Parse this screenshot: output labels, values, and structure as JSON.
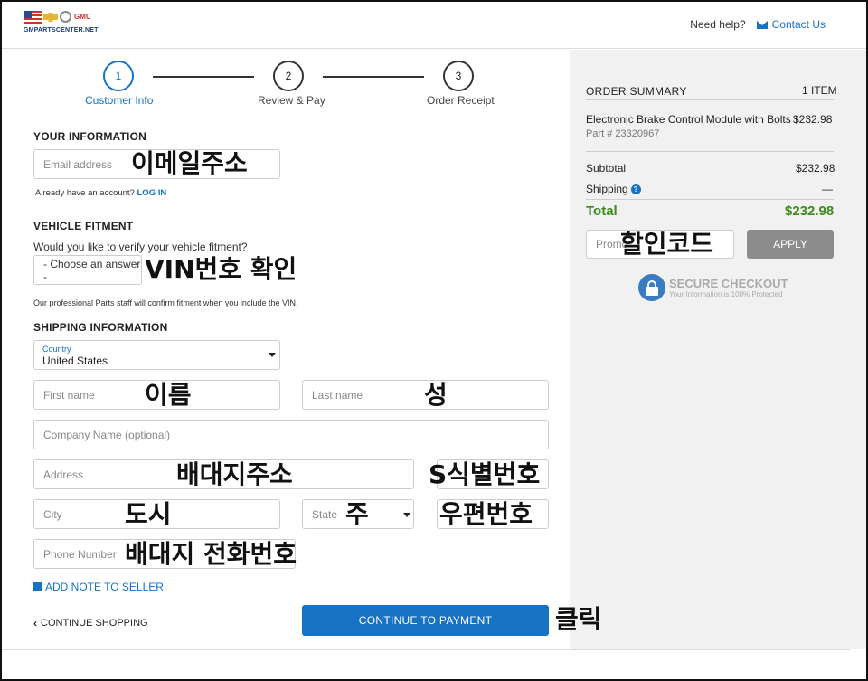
{
  "header": {
    "logo_text": "GMPARTSCENTER.NET",
    "logo_gmc": "GMC",
    "help_text": "Need help?",
    "contact_label": "Contact Us"
  },
  "steps": [
    {
      "num": "1",
      "label": "Customer Info"
    },
    {
      "num": "2",
      "label": "Review & Pay"
    },
    {
      "num": "3",
      "label": "Order Receipt"
    }
  ],
  "your_info": {
    "title": "YOUR INFORMATION",
    "email_placeholder": "Email address",
    "email_annotation": "이메일주소",
    "account_prompt": "Already have an account?",
    "login_link": "LOG IN"
  },
  "vehicle": {
    "title": "VEHICLE FITMENT",
    "question": "Would you like to verify your vehicle fitment?",
    "select_value": "- Choose an answer -",
    "select_annotation": "VIN번호 확인",
    "note": "Our professional Parts staff will confirm fitment when you include the VIN."
  },
  "shipping": {
    "title": "SHIPPING INFORMATION",
    "country_label": "Country",
    "country_value": "United States",
    "first_name_placeholder": "First name",
    "first_name_annotation": "이름",
    "last_name_placeholder": "Last name",
    "last_name_annotation": "성",
    "company_placeholder": "Company Name (optional)",
    "address_placeholder": "Address",
    "address_annotation": "배대지주소",
    "address2_annotation": "S식별번호",
    "city_placeholder": "City",
    "city_annotation": "도시",
    "state_placeholder": "State",
    "state_annotation": "주",
    "zip_annotation": "우편번호",
    "phone_placeholder": "Phone Number",
    "phone_annotation": "배대지 전화번호",
    "add_note": "ADD NOTE TO SELLER"
  },
  "actions": {
    "continue_shopping": "CONTINUE SHOPPING",
    "continue_payment": "CONTINUE TO PAYMENT",
    "click_annotation": "클릭"
  },
  "summary": {
    "title": "ORDER SUMMARY",
    "item_count": "1 ITEM",
    "product_name": "Electronic Brake Control Module with Bolts",
    "product_price": "$232.98",
    "part_number": "Part # 23320967",
    "subtotal_label": "Subtotal",
    "subtotal_value": "$232.98",
    "shipping_label": "Shipping",
    "shipping_value": "—",
    "total_label": "Total",
    "total_value": "$232.98",
    "promo_placeholder": "Promo",
    "promo_annotation": "할인코드",
    "apply_label": "APPLY",
    "secure_title": "SECURE CHECKOUT",
    "secure_sub": "Your Information is 100% Protected"
  },
  "colors": {
    "accent": "#1672c4",
    "total": "#3f8a1f",
    "apply": "#8c8c8c"
  }
}
